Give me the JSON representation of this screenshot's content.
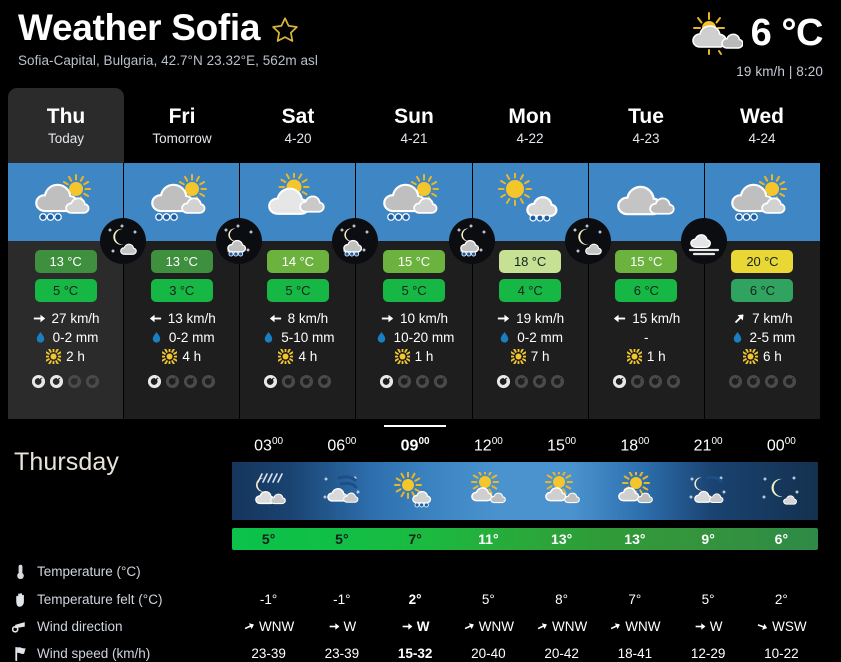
{
  "header": {
    "title": "Weather Sofia",
    "favorite_icon": "star-outline-icon",
    "subtitle": "Sofia-Capital, Bulgaria, 42.7°N 23.32°E, 562m asl",
    "current_icon": "sun-behind-cloud-icon",
    "current_temp": "6 °C",
    "current_meta": "19 km/h  |  8:20"
  },
  "tabs": [
    {
      "day": "Thu",
      "sub": "Today",
      "active": true
    },
    {
      "day": "Fri",
      "sub": "Tomorrow",
      "active": false
    },
    {
      "day": "Sat",
      "sub": "4-20",
      "active": false
    },
    {
      "day": "Sun",
      "sub": "4-21",
      "active": false
    },
    {
      "day": "Mon",
      "sub": "4-22",
      "active": false
    },
    {
      "day": "Tue",
      "sub": "4-23",
      "active": false
    },
    {
      "day": "Wed",
      "sub": "4-24",
      "active": false
    }
  ],
  "day_cards": [
    {
      "day_icon": "sun-behind-rain-cloud-icon",
      "night_icon": "moon-cloud-icon",
      "tmax": "13 °C",
      "tmax_color": "#3e8f3e",
      "tmax_text": "#ffffff",
      "tmin": "5 °C",
      "tmin_color": "#17b745",
      "tmin_text": "#16241b",
      "wind": "27 km/h",
      "wind_dir_icon": "arrow-east-icon",
      "wind_rotation": 0,
      "precip": "0-2 mm",
      "sun": "2 h",
      "reliability": 2
    },
    {
      "day_icon": "sun-behind-rain-cloud-icon",
      "night_icon": "rain-cloud-night-icon",
      "tmax": "13 °C",
      "tmax_color": "#3e8f3e",
      "tmax_text": "#ffffff",
      "tmin": "3 °C",
      "tmin_color": "#17b745",
      "tmin_text": "#16241b",
      "wind": "13 km/h",
      "wind_dir_icon": "arrow-west-icon",
      "wind_rotation": 180,
      "precip": "0-2 mm",
      "sun": "4 h",
      "reliability": 1
    },
    {
      "day_icon": "sun-behind-cloud-icon",
      "night_icon": "rain-cloud-night-icon",
      "tmax": "14 °C",
      "tmax_color": "#6cb23f",
      "tmax_text": "#ffffff",
      "tmin": "5 °C",
      "tmin_color": "#17b745",
      "tmin_text": "#16241b",
      "wind": "8 km/h",
      "wind_dir_icon": "arrow-west-icon",
      "wind_rotation": 180,
      "precip": "5-10 mm",
      "sun": "4 h",
      "reliability": 1
    },
    {
      "day_icon": "sun-behind-rain-cloud-icon",
      "night_icon": "rain-cloud-night-icon",
      "tmax": "15 °C",
      "tmax_color": "#6cb23f",
      "tmax_text": "#ffffff",
      "tmin": "5 °C",
      "tmin_color": "#17b745",
      "tmin_text": "#16241b",
      "wind": "10 km/h",
      "wind_dir_icon": "arrow-east-icon",
      "wind_rotation": 0,
      "precip": "10-20 mm",
      "sun": "1 h",
      "reliability": 1
    },
    {
      "day_icon": "sun-behind-small-rain-cloud-icon",
      "night_icon": "moon-cloud-icon",
      "tmax": "18 °C",
      "tmax_color": "#c6e094",
      "tmax_text": "#16241b",
      "tmin": "4 °C",
      "tmin_color": "#17b745",
      "tmin_text": "#16241b",
      "wind": "19 km/h",
      "wind_dir_icon": "arrow-east-icon",
      "wind_rotation": 0,
      "precip": "0-2 mm",
      "sun": "7 h",
      "reliability": 1
    },
    {
      "day_icon": "cloudy-icon",
      "night_icon": "fog-night-icon",
      "tmax": "15 °C",
      "tmax_color": "#6cb23f",
      "tmax_text": "#ffffff",
      "tmin": "6 °C",
      "tmin_color": "#17b745",
      "tmin_text": "#16241b",
      "wind": "15 km/h",
      "wind_dir_icon": "arrow-west-icon",
      "wind_rotation": 180,
      "precip": "-",
      "sun": "1 h",
      "reliability": 1
    },
    {
      "day_icon": "sun-behind-rain-cloud-icon",
      "night_icon": "fog-night-icon",
      "tmax": "20 °C",
      "tmax_color": "#e8d734",
      "tmax_text": "#16241b",
      "tmin": "6 °C",
      "tmin_color": "#2fa35f",
      "tmin_text": "#16241b",
      "wind": "7 km/h",
      "wind_dir_icon": "arrow-northeast-icon",
      "wind_rotation": -45,
      "precip": "2-5 mm",
      "sun": "6 h",
      "reliability": 0
    }
  ],
  "hourly": {
    "day_label": "Thursday",
    "selected_index": 2,
    "times": [
      {
        "hour": "03",
        "min": "00"
      },
      {
        "hour": "06",
        "min": "00"
      },
      {
        "hour": "09",
        "min": "00"
      },
      {
        "hour": "12",
        "min": "00"
      },
      {
        "hour": "15",
        "min": "00"
      },
      {
        "hour": "18",
        "min": "00"
      },
      {
        "hour": "21",
        "min": "00"
      },
      {
        "hour": "00",
        "min": "00"
      }
    ],
    "icons": [
      "moon-rain-wind-icon",
      "moon-snow-wind-icon",
      "sun-rain-shower-icon",
      "sun-behind-cloud-icon",
      "sun-behind-cloud-icon",
      "sun-cloud-wind-icon",
      "moon-cloud-wind-icon",
      "moon-clear-icon"
    ],
    "rows": [
      {
        "label": "Temperature (°C)",
        "icon": "thermometer-icon",
        "is_temp_bar": true,
        "values": [
          "5°",
          "5°",
          "7°",
          "11°",
          "13°",
          "13°",
          "9°",
          "6°"
        ],
        "value_styles": [
          "dark",
          "dark",
          "dark",
          "light",
          "light",
          "light",
          "light",
          "light"
        ]
      },
      {
        "label": "Temperature felt (°C)",
        "icon": "hand-icon",
        "is_temp_bar": false,
        "values": [
          "-1°",
          "-1°",
          "2°",
          "5°",
          "8°",
          "7°",
          "5°",
          "2°"
        ]
      },
      {
        "label": "Wind direction",
        "icon": "windsock-icon",
        "is_temp_bar": false,
        "values": [
          "WNW",
          "W",
          "W",
          "WNW",
          "WNW",
          "WNW",
          "W",
          "WSW"
        ],
        "arrows": [
          -25,
          0,
          0,
          -25,
          -25,
          -25,
          0,
          20
        ]
      },
      {
        "label": "Wind speed (km/h)",
        "icon": "flag-icon",
        "is_temp_bar": false,
        "values": [
          "23-39",
          "23-39",
          "15-32",
          "20-40",
          "20-42",
          "18-41",
          "12-29",
          "10-22"
        ]
      }
    ]
  },
  "colors": {
    "background": "#000000",
    "card_bg": "#1e1e1e",
    "card_active_bg": "#2b2b2b",
    "sky_blue": "#3e87c4",
    "accent_star": "#d8b53a"
  }
}
